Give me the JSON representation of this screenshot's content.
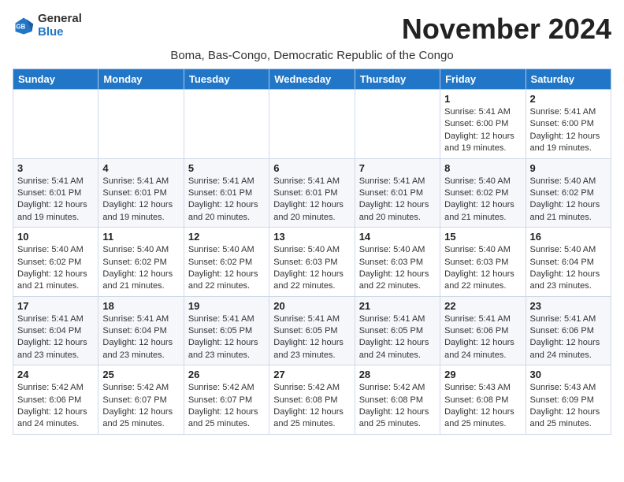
{
  "logo": {
    "general": "General",
    "blue": "Blue"
  },
  "title": "November 2024",
  "subtitle": "Boma, Bas-Congo, Democratic Republic of the Congo",
  "days_of_week": [
    "Sunday",
    "Monday",
    "Tuesday",
    "Wednesday",
    "Thursday",
    "Friday",
    "Saturday"
  ],
  "weeks": [
    [
      {
        "day": "",
        "info": ""
      },
      {
        "day": "",
        "info": ""
      },
      {
        "day": "",
        "info": ""
      },
      {
        "day": "",
        "info": ""
      },
      {
        "day": "",
        "info": ""
      },
      {
        "day": "1",
        "info": "Sunrise: 5:41 AM\nSunset: 6:00 PM\nDaylight: 12 hours and 19 minutes."
      },
      {
        "day": "2",
        "info": "Sunrise: 5:41 AM\nSunset: 6:00 PM\nDaylight: 12 hours and 19 minutes."
      }
    ],
    [
      {
        "day": "3",
        "info": "Sunrise: 5:41 AM\nSunset: 6:01 PM\nDaylight: 12 hours and 19 minutes."
      },
      {
        "day": "4",
        "info": "Sunrise: 5:41 AM\nSunset: 6:01 PM\nDaylight: 12 hours and 19 minutes."
      },
      {
        "day": "5",
        "info": "Sunrise: 5:41 AM\nSunset: 6:01 PM\nDaylight: 12 hours and 20 minutes."
      },
      {
        "day": "6",
        "info": "Sunrise: 5:41 AM\nSunset: 6:01 PM\nDaylight: 12 hours and 20 minutes."
      },
      {
        "day": "7",
        "info": "Sunrise: 5:41 AM\nSunset: 6:01 PM\nDaylight: 12 hours and 20 minutes."
      },
      {
        "day": "8",
        "info": "Sunrise: 5:40 AM\nSunset: 6:02 PM\nDaylight: 12 hours and 21 minutes."
      },
      {
        "day": "9",
        "info": "Sunrise: 5:40 AM\nSunset: 6:02 PM\nDaylight: 12 hours and 21 minutes."
      }
    ],
    [
      {
        "day": "10",
        "info": "Sunrise: 5:40 AM\nSunset: 6:02 PM\nDaylight: 12 hours and 21 minutes."
      },
      {
        "day": "11",
        "info": "Sunrise: 5:40 AM\nSunset: 6:02 PM\nDaylight: 12 hours and 21 minutes."
      },
      {
        "day": "12",
        "info": "Sunrise: 5:40 AM\nSunset: 6:02 PM\nDaylight: 12 hours and 22 minutes."
      },
      {
        "day": "13",
        "info": "Sunrise: 5:40 AM\nSunset: 6:03 PM\nDaylight: 12 hours and 22 minutes."
      },
      {
        "day": "14",
        "info": "Sunrise: 5:40 AM\nSunset: 6:03 PM\nDaylight: 12 hours and 22 minutes."
      },
      {
        "day": "15",
        "info": "Sunrise: 5:40 AM\nSunset: 6:03 PM\nDaylight: 12 hours and 22 minutes."
      },
      {
        "day": "16",
        "info": "Sunrise: 5:40 AM\nSunset: 6:04 PM\nDaylight: 12 hours and 23 minutes."
      }
    ],
    [
      {
        "day": "17",
        "info": "Sunrise: 5:41 AM\nSunset: 6:04 PM\nDaylight: 12 hours and 23 minutes."
      },
      {
        "day": "18",
        "info": "Sunrise: 5:41 AM\nSunset: 6:04 PM\nDaylight: 12 hours and 23 minutes."
      },
      {
        "day": "19",
        "info": "Sunrise: 5:41 AM\nSunset: 6:05 PM\nDaylight: 12 hours and 23 minutes."
      },
      {
        "day": "20",
        "info": "Sunrise: 5:41 AM\nSunset: 6:05 PM\nDaylight: 12 hours and 23 minutes."
      },
      {
        "day": "21",
        "info": "Sunrise: 5:41 AM\nSunset: 6:05 PM\nDaylight: 12 hours and 24 minutes."
      },
      {
        "day": "22",
        "info": "Sunrise: 5:41 AM\nSunset: 6:06 PM\nDaylight: 12 hours and 24 minutes."
      },
      {
        "day": "23",
        "info": "Sunrise: 5:41 AM\nSunset: 6:06 PM\nDaylight: 12 hours and 24 minutes."
      }
    ],
    [
      {
        "day": "24",
        "info": "Sunrise: 5:42 AM\nSunset: 6:06 PM\nDaylight: 12 hours and 24 minutes."
      },
      {
        "day": "25",
        "info": "Sunrise: 5:42 AM\nSunset: 6:07 PM\nDaylight: 12 hours and 25 minutes."
      },
      {
        "day": "26",
        "info": "Sunrise: 5:42 AM\nSunset: 6:07 PM\nDaylight: 12 hours and 25 minutes."
      },
      {
        "day": "27",
        "info": "Sunrise: 5:42 AM\nSunset: 6:08 PM\nDaylight: 12 hours and 25 minutes."
      },
      {
        "day": "28",
        "info": "Sunrise: 5:42 AM\nSunset: 6:08 PM\nDaylight: 12 hours and 25 minutes."
      },
      {
        "day": "29",
        "info": "Sunrise: 5:43 AM\nSunset: 6:08 PM\nDaylight: 12 hours and 25 minutes."
      },
      {
        "day": "30",
        "info": "Sunrise: 5:43 AM\nSunset: 6:09 PM\nDaylight: 12 hours and 25 minutes."
      }
    ]
  ]
}
